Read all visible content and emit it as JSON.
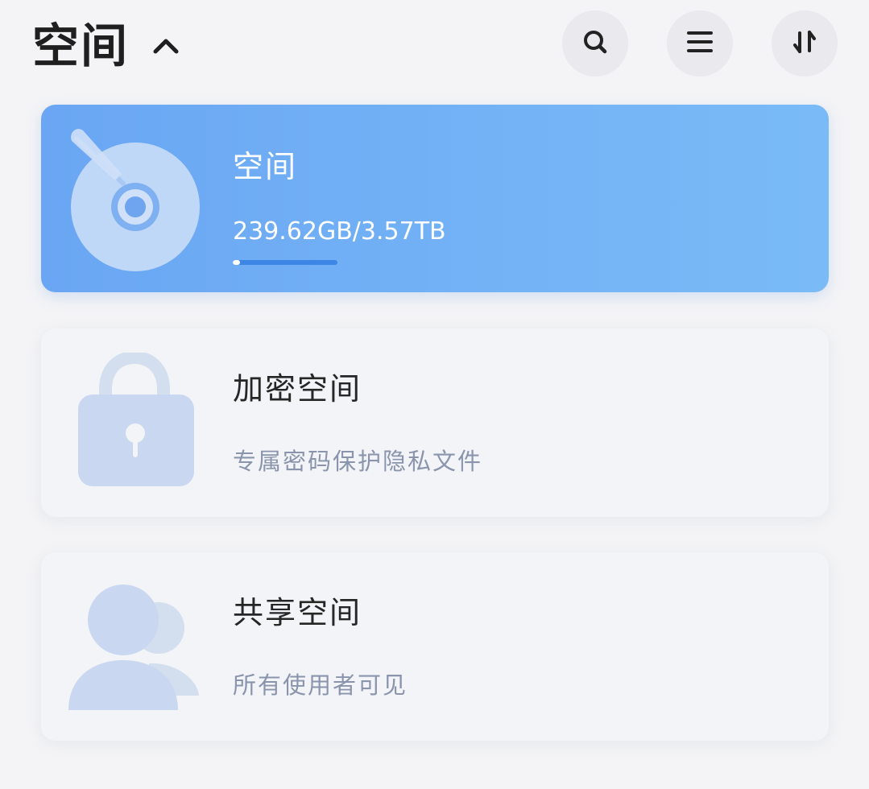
{
  "header": {
    "title": "空间",
    "chevron_icon": "chevron-up-icon",
    "actions": [
      {
        "icon": "search-icon"
      },
      {
        "icon": "menu-icon"
      },
      {
        "icon": "sort-icon"
      }
    ]
  },
  "cards": {
    "space": {
      "title": "空间",
      "usage": "239.62GB/3.57TB",
      "used_fraction": 0.066,
      "icon": "disc-icon"
    },
    "encrypted": {
      "title": "加密空间",
      "subtitle": "专属密码保护隐私文件",
      "icon": "lock-icon"
    },
    "shared": {
      "title": "共享空间",
      "subtitle": "所有使用者可见",
      "icon": "users-icon"
    }
  },
  "colors": {
    "primary_card_start": "#6aa6f3",
    "primary_card_end": "#79baf7",
    "subtitle": "#8a94ad",
    "icon_light_blue": "#c9d8f0"
  }
}
